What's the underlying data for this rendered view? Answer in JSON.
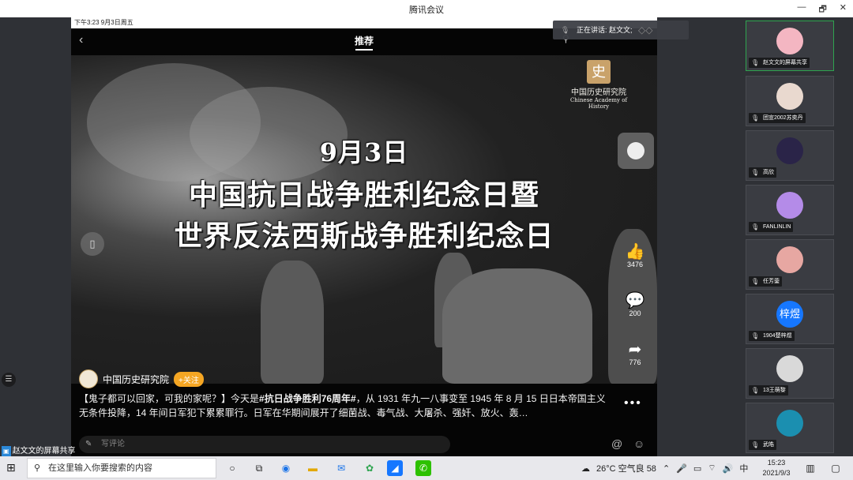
{
  "window": {
    "title": "腾讯会议",
    "controls": [
      "—",
      "🗗",
      "✕"
    ]
  },
  "phone": {
    "status": "下午3:23  9月3日周五",
    "nav_tab": "推荐",
    "logo_cn": "中国历史研究院",
    "logo_en": "Chinese Academy of History",
    "headline": [
      "9月3日",
      "中国抗日战争胜利纪念日暨",
      "世界反法西斯战争胜利纪念日"
    ],
    "likes": "3476",
    "comments": "200",
    "shares": "776",
    "author": "中国历史研究院",
    "follow": "+关注",
    "desc_prefix": "【鬼子都可以回家，可我的家呢？】今天是",
    "desc_tag": "#抗日战争胜利76周年#",
    "desc_rest": "，从 1931 年九一八事变至 1945 年 8 月 15 日日本帝国主义无条件投降，14 年间日军犯下累累罪行。日军在华期间展开了细菌战、毒气战、大屠杀、强奸、放火、轰…",
    "comment_placeholder": "写评论"
  },
  "speaking": {
    "text": "正在讲话: 赵文文;"
  },
  "share_bar": {
    "text": "赵文文的屏幕共享"
  },
  "participants": [
    {
      "name": "赵文文的屏幕共享",
      "color": "#f4b6c2",
      "active": true
    },
    {
      "name": "团宣2002苏奕丹",
      "color": "#e9d9cf"
    },
    {
      "name": "高欣",
      "color": "#2a2448"
    },
    {
      "name": "FANLINLIN",
      "color": "#b48be8"
    },
    {
      "name": "任芳蓥",
      "color": "#e7a7a2"
    },
    {
      "name": "1904楚梓煜",
      "badge": "梓煜",
      "color": "#1677ff"
    },
    {
      "name": "13王萌黎",
      "color": "#d9d9d9"
    },
    {
      "name": "武皓",
      "color": "#1b8fb0"
    }
  ],
  "taskbar": {
    "search_placeholder": "在这里输入你要搜索的内容",
    "weather": "26°C 空气良 58",
    "ime": "中",
    "time": "15:23",
    "date": "2021/9/3"
  }
}
